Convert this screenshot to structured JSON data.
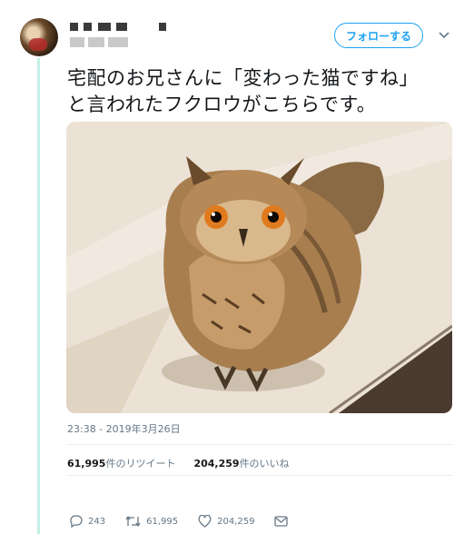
{
  "tweet": {
    "follow_label": "フォローする",
    "text": "宅配のお兄さんに「変わった猫ですね」\nと言われたフクロウがこちらです。",
    "photo_icon": "owl-photo",
    "timestamp": "23:38 - 2019年3月26日",
    "retweets_count": "61,995",
    "retweets_label": "件のリツイート",
    "likes_count": "204,259",
    "likes_label": "件のいいね"
  },
  "actions": {
    "reply_count": "243",
    "retweet_count": "61,995",
    "like_count": "204,259"
  },
  "colors": {
    "accent": "#1da1f2",
    "thread_line": "#c2f0e6",
    "muted": "#657786"
  }
}
